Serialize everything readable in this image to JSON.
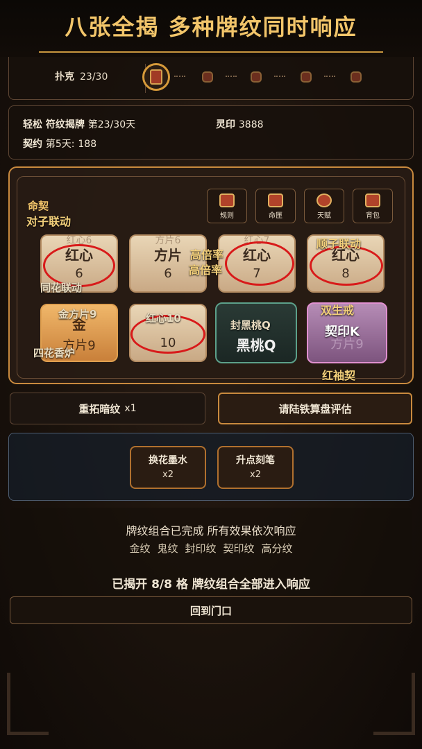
{
  "banner": {
    "title": "八张全揭  多种牌纹同时响应"
  },
  "progress": {
    "label": "扑克",
    "value": "23/30",
    "relics": [
      "relic-scroll-icon",
      "relic-chest-icon",
      "relic-bag-icon",
      "relic-lantern-icon",
      "relic-hammer-icon"
    ]
  },
  "info": {
    "mode": "轻松",
    "stage_label": "符纹揭牌",
    "stage_value": "第23/30天",
    "seal_label": "灵印",
    "seal_value": "3888",
    "contract_label": "契约",
    "contract_day": "第5天:",
    "contract_value": "188"
  },
  "board": {
    "title": "命契",
    "tools": [
      {
        "label": "规则",
        "icon": "rules-icon"
      },
      {
        "label": "命匣",
        "icon": "fate-box-icon"
      },
      {
        "label": "天赋",
        "icon": "talent-icon"
      },
      {
        "label": "背包",
        "icon": "backpack-icon"
      }
    ],
    "labels": {
      "pair": "对子联动",
      "high_mult_a": "高倍率",
      "high_mult_b": "高倍率",
      "straight": "顺子联动",
      "flush": "同花联动",
      "gold_square": "金方片9",
      "twin_ring": "双生戒",
      "four_flush": "四花香炉",
      "red_sleeve": "红袖契",
      "hearts_10": "红心10",
      "sealed_spade": "封黑桃Q",
      "contract_k": "契印K"
    },
    "cards": [
      {
        "ghost": "红心6",
        "name": "红心",
        "rank": "6",
        "style": "plain"
      },
      {
        "ghost": "方片6",
        "name": "方片",
        "rank": "6",
        "style": "plain"
      },
      {
        "ghost": "红心7",
        "name": "红心",
        "rank": "7",
        "style": "plain"
      },
      {
        "ghost": "",
        "name": "红心",
        "rank": "8",
        "style": "plain"
      },
      {
        "ghost": "",
        "name": "金",
        "rank": "方片9",
        "style": "gold"
      },
      {
        "ghost": "",
        "name": "",
        "rank": "10",
        "style": "plain"
      },
      {
        "ghost": "",
        "name": "黑桃Q",
        "rank": "",
        "style": "dark"
      },
      {
        "ghost": "",
        "name": "",
        "rank": "方片9",
        "style": "purple"
      }
    ]
  },
  "actions": {
    "reroll_label": "重拓暗纹",
    "reroll_count": "x1",
    "evaluate_label": "请陆铁算盘评估"
  },
  "consumables": [
    {
      "name": "换花墨水",
      "count": "x2"
    },
    {
      "name": "升点刻笔",
      "count": "x2"
    }
  ],
  "result": {
    "line1": "牌纹组合已完成  所有效果依次响应",
    "types": [
      "金纹",
      "鬼纹",
      "封印纹",
      "契印纹",
      "高分纹"
    ],
    "summary": "已揭开 8/8 格  牌纹组合全部进入响应",
    "return_label": "回到门口"
  }
}
